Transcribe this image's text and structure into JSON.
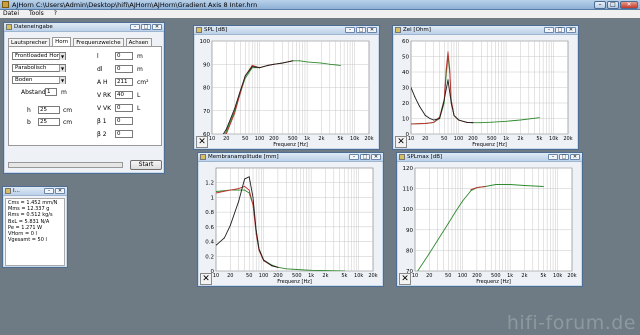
{
  "app": {
    "title": "AJHorn   C:\\Users\\Admin\\Desktop\\hifi\\AJHorn\\AJHorn\\Gradient Axis 8 Inter.hrn",
    "menu": [
      "Datei",
      "Tools",
      "?"
    ],
    "window_controls": [
      "–",
      "□",
      "✕"
    ]
  },
  "dialog": {
    "title": "Dateneingabe",
    "tabs": [
      "Lautsprecher",
      "Horn",
      "Frequenzweiche",
      "Achsen"
    ],
    "active_tab": "Horn",
    "selects": {
      "horn_type": "Frontloaded Horn",
      "contour": "Parabolisch",
      "position": "Boden"
    },
    "abstand_label": "Abstand",
    "abstand_value": "1",
    "abstand_unit": "m",
    "h_label": "h",
    "h_value": "25",
    "h_unit": "cm",
    "b_label": "b",
    "b_value": "25",
    "b_unit": "cm",
    "params": [
      {
        "label": "l",
        "value": "0",
        "unit": "m"
      },
      {
        "label": "dl",
        "value": "0",
        "unit": "m"
      },
      {
        "label": "A H",
        "value": "211",
        "unit": "cm²"
      },
      {
        "label": "V RK",
        "value": "40",
        "unit": "L"
      },
      {
        "label": "V VK",
        "value": "0",
        "unit": "L"
      },
      {
        "label": "β 1",
        "value": "0",
        "unit": ""
      },
      {
        "label": "β 2",
        "value": "0",
        "unit": ""
      }
    ],
    "start_label": "Start"
  },
  "info": {
    "title": "I...",
    "lines": [
      "Cms = 1.452 mm/N",
      "Mms = 12.337 g",
      "Rms = 0.512 kg/s",
      "BxL = 5.831 N/A",
      "Pe = 1.271 W",
      "VHorn = 0 l",
      "Vgesamt = 50 l"
    ]
  },
  "charts": {
    "spl": {
      "title": "SPL [dB]"
    },
    "zel": {
      "title": "Zel [Ohm]"
    },
    "membran": {
      "title": "Membranamplitude [mm]"
    },
    "splmax": {
      "title": "SPLmax [dB]"
    }
  },
  "chart_data": [
    {
      "type": "line",
      "title": "SPL [dB]",
      "xlabel": "Frequenz [Hz]",
      "x_scale": "log",
      "xlim": [
        10,
        20000
      ],
      "ylim": [
        60,
        100
      ],
      "yticks": [
        60,
        70,
        80,
        90,
        100
      ],
      "xticks": [
        "10",
        "20",
        "50",
        "100",
        "200",
        "500",
        "1k",
        "2k",
        "5k",
        "10k",
        "20k"
      ],
      "grid": true,
      "series": [
        {
          "color": "#2f8a2f",
          "x": [
            10,
            15,
            20,
            30,
            40,
            50,
            70,
            100,
            150,
            200,
            300,
            500,
            700,
            1000,
            2000,
            3000,
            5000
          ],
          "y": [
            51,
            57,
            61,
            70,
            78,
            84,
            88.5,
            88.5,
            89.5,
            90,
            90.5,
            91.5,
            91.5,
            91,
            90.5,
            90,
            89.5
          ]
        },
        {
          "color": "#c03030",
          "x": [
            10,
            15,
            20,
            30,
            40,
            50,
            70,
            100,
            150,
            200,
            300,
            500
          ],
          "y": [
            50,
            56,
            60,
            69,
            78,
            85,
            89.5,
            88.5,
            89.5,
            90,
            90.5,
            91.5
          ]
        },
        {
          "color": "#202020",
          "x": [
            10,
            15,
            20,
            30,
            40,
            50,
            70,
            100,
            150,
            200,
            300,
            500
          ],
          "y": [
            52,
            58,
            62,
            71,
            79,
            85,
            89,
            88.5,
            89.5,
            90,
            90.5,
            91.5
          ]
        }
      ]
    },
    {
      "type": "line",
      "title": "Zel [Ohm]",
      "xlabel": "Frequenz [Hz]",
      "x_scale": "log",
      "xlim": [
        10,
        20000
      ],
      "ylim": [
        0,
        60
      ],
      "yticks": [
        0,
        10,
        20,
        30,
        40,
        50,
        60
      ],
      "xticks": [
        "10",
        "20",
        "50",
        "100",
        "200",
        "500",
        "1k",
        "2k",
        "5k",
        "10k",
        "20k"
      ],
      "grid": true,
      "series": [
        {
          "color": "#2f8a2f",
          "x": [
            10,
            20,
            30,
            40,
            50,
            55,
            60,
            65,
            70,
            80,
            100,
            150,
            200,
            300,
            500,
            1000,
            2000,
            5000
          ],
          "y": [
            6.5,
            6.8,
            7.5,
            10,
            20,
            38,
            50,
            40,
            22,
            12,
            9,
            7.5,
            7.3,
            7.3,
            7.6,
            8.2,
            9,
            10.5
          ]
        },
        {
          "color": "#c03030",
          "x": [
            10,
            20,
            30,
            40,
            50,
            55,
            60,
            65,
            70,
            80,
            100,
            150,
            200
          ],
          "y": [
            6.5,
            6.8,
            7.5,
            11,
            22,
            42,
            53,
            42,
            22,
            12,
            9,
            7.5,
            7.3
          ]
        },
        {
          "color": "#202020",
          "x": [
            10,
            12,
            15,
            20,
            25,
            30,
            40,
            50,
            60,
            70,
            80,
            100,
            150,
            200
          ],
          "y": [
            30,
            24,
            18,
            12,
            10,
            9,
            10,
            22,
            35,
            20,
            12,
            9,
            7.5,
            7.3
          ]
        }
      ]
    },
    {
      "type": "line",
      "title": "Membranamplitude [mm]",
      "xlabel": "Frequenz [Hz]",
      "x_scale": "log",
      "xlim": [
        10,
        20000
      ],
      "ylim": [
        0,
        1.4
      ],
      "yticks": [
        0,
        0.2,
        0.4,
        0.6,
        0.8,
        1,
        1.2
      ],
      "xticks": [
        "10",
        "20",
        "50",
        "100",
        "200",
        "500",
        "1k",
        "2k",
        "5k",
        "10k",
        "20k"
      ],
      "grid": true,
      "series": [
        {
          "color": "#2f8a2f",
          "x": [
            10,
            20,
            30,
            40,
            50,
            60,
            70,
            80,
            100,
            150,
            200,
            300,
            500,
            1000,
            2000,
            5000
          ],
          "y": [
            1.08,
            1.1,
            1.1,
            1.1,
            1.06,
            0.9,
            0.55,
            0.3,
            0.15,
            0.08,
            0.05,
            0.03,
            0.02,
            0.01,
            0.005,
            0.002
          ]
        },
        {
          "color": "#c03030",
          "x": [
            10,
            20,
            30,
            40,
            50,
            60,
            70,
            80,
            100,
            150,
            200
          ],
          "y": [
            1.06,
            1.1,
            1.12,
            1.15,
            1.1,
            0.9,
            0.5,
            0.28,
            0.14,
            0.07,
            0.05
          ]
        },
        {
          "color": "#202020",
          "x": [
            10,
            15,
            20,
            30,
            40,
            50,
            60,
            70,
            80,
            100,
            150,
            200
          ],
          "y": [
            0.35,
            0.45,
            0.62,
            0.95,
            1.25,
            1.28,
            1.0,
            0.55,
            0.3,
            0.15,
            0.07,
            0.05
          ]
        }
      ]
    },
    {
      "type": "line",
      "title": "SPLmax [dB]",
      "xlabel": "Frequenz [Hz]",
      "x_scale": "log",
      "xlim": [
        10,
        20000
      ],
      "ylim": [
        70,
        120
      ],
      "yticks": [
        70,
        80,
        90,
        100,
        110,
        120
      ],
      "xticks": [
        "10",
        "20",
        "50",
        "100",
        "200",
        "500",
        "1k",
        "2k",
        "5k",
        "10k",
        "20k"
      ],
      "grid": true,
      "series": [
        {
          "color": "#2f8a2f",
          "x": [
            10,
            20,
            30,
            50,
            70,
            100,
            150,
            200,
            300,
            500,
            1000,
            2000,
            5000
          ],
          "y": [
            68,
            78.5,
            85,
            93,
            98.5,
            104,
            109,
            110.5,
            111,
            112,
            112,
            111.5,
            111
          ]
        },
        {
          "color": "#c03030",
          "x": [
            150,
            200,
            300
          ],
          "y": [
            109.5,
            110.5,
            111
          ]
        }
      ]
    }
  ],
  "watermark": "hifi-forum.de"
}
